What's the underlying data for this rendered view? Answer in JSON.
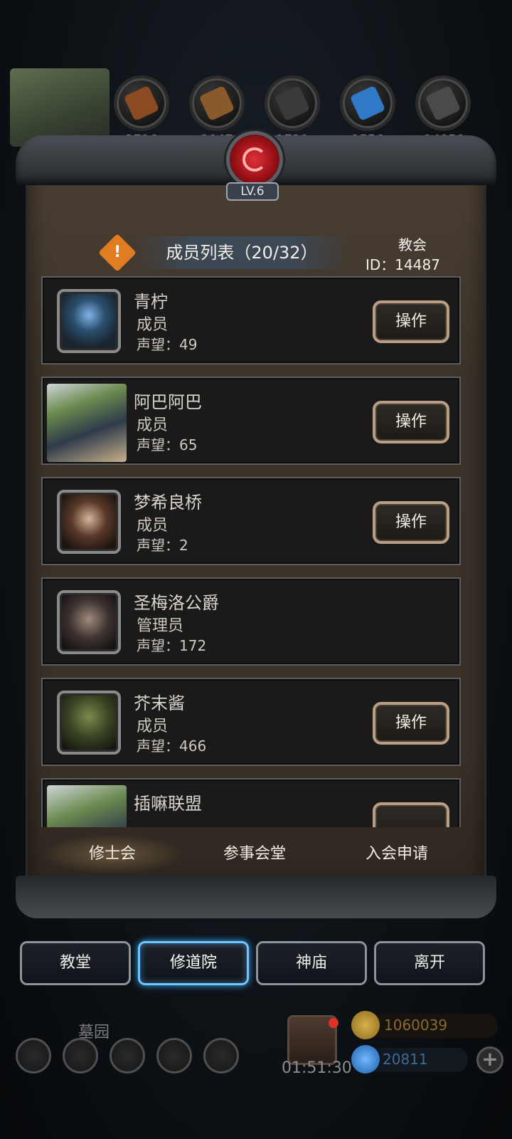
{
  "top": {
    "resources": [
      "3716",
      "2047",
      "1720",
      "1556",
      "14858"
    ]
  },
  "panel": {
    "level": "LV.6",
    "list_title": "成员列表（20/32）",
    "guild_type": "教会",
    "guild_id": "ID：14487",
    "warning_icon": "!"
  },
  "members": [
    {
      "name": "青柠",
      "role": "成员",
      "reputation": "声望：49",
      "action": "操作"
    },
    {
      "name": "阿巴阿巴",
      "role": "成员",
      "reputation": "声望：65",
      "action": "操作"
    },
    {
      "name": "梦希良桥",
      "role": "成员",
      "reputation": "声望：2",
      "action": "操作"
    },
    {
      "name": "圣梅洛公爵",
      "role": "管理员",
      "reputation": "声望：172",
      "action": ""
    },
    {
      "name": "芥末酱",
      "role": "成员",
      "reputation": "声望：466",
      "action": "操作"
    },
    {
      "name": "插嘛联盟",
      "role": "",
      "reputation": "",
      "action": ""
    }
  ],
  "tabs": [
    "修士会",
    "参事会堂",
    "入会申请"
  ],
  "active_tab": 0,
  "nav": [
    "教堂",
    "修道院",
    "神庙",
    "离开"
  ],
  "active_nav": 1,
  "hud": {
    "graveyard": "墓园",
    "timer": "01:51:30",
    "gold": "1060039",
    "gems": "20811",
    "plus": "+"
  },
  "colors": {
    "accent_active": "#6fc7ff",
    "button_border": "#b89e84",
    "warning": "#e07d23",
    "emblem": "#c8181f"
  }
}
